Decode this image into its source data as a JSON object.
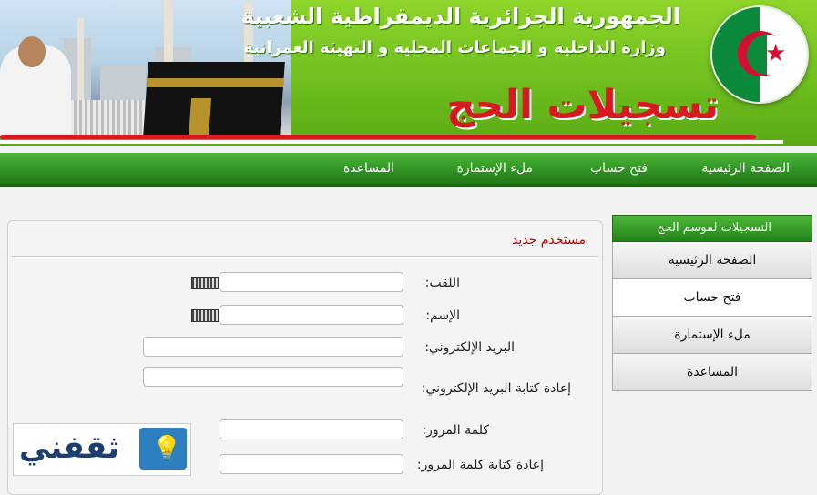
{
  "header": {
    "republic": "الجمهورية الجزائرية الديمقراطية الشعبية",
    "ministry": "وزارة الداخلية و الجماعات المحلية و التهيئة العمرانية",
    "site_title": "تسجيلات الحج"
  },
  "nav": {
    "items": [
      "الصفحة الرئيسية",
      "فتح حساب",
      "ملء الإستمارة",
      "المساعدة"
    ]
  },
  "form": {
    "heading": "مستخدم جديد",
    "fields": {
      "surname": "اللقب:",
      "name": "الإسم:",
      "email": "البريد الإلكتروني:",
      "email_confirm": "إعادة كتابة البريد الإلكتروني:",
      "password": "كلمة المرور:",
      "password_confirm": "إعادة كتابة كلمة المرور:"
    }
  },
  "sidebar": {
    "title": "التسجيلات لموسم الحج",
    "items": [
      "الصفحة الرئيسية",
      "فتح حساب",
      "ملء الإستمارة",
      "المساعدة"
    ]
  },
  "watermark": {
    "text": "ثقفني"
  },
  "icons": [
    "keyboard-icon",
    "lightbulb-icon",
    "algeria-flag-icon"
  ],
  "colors": {
    "accent_green": "#3fa52f",
    "title_red": "#d71920",
    "heading_red": "#c00000"
  }
}
